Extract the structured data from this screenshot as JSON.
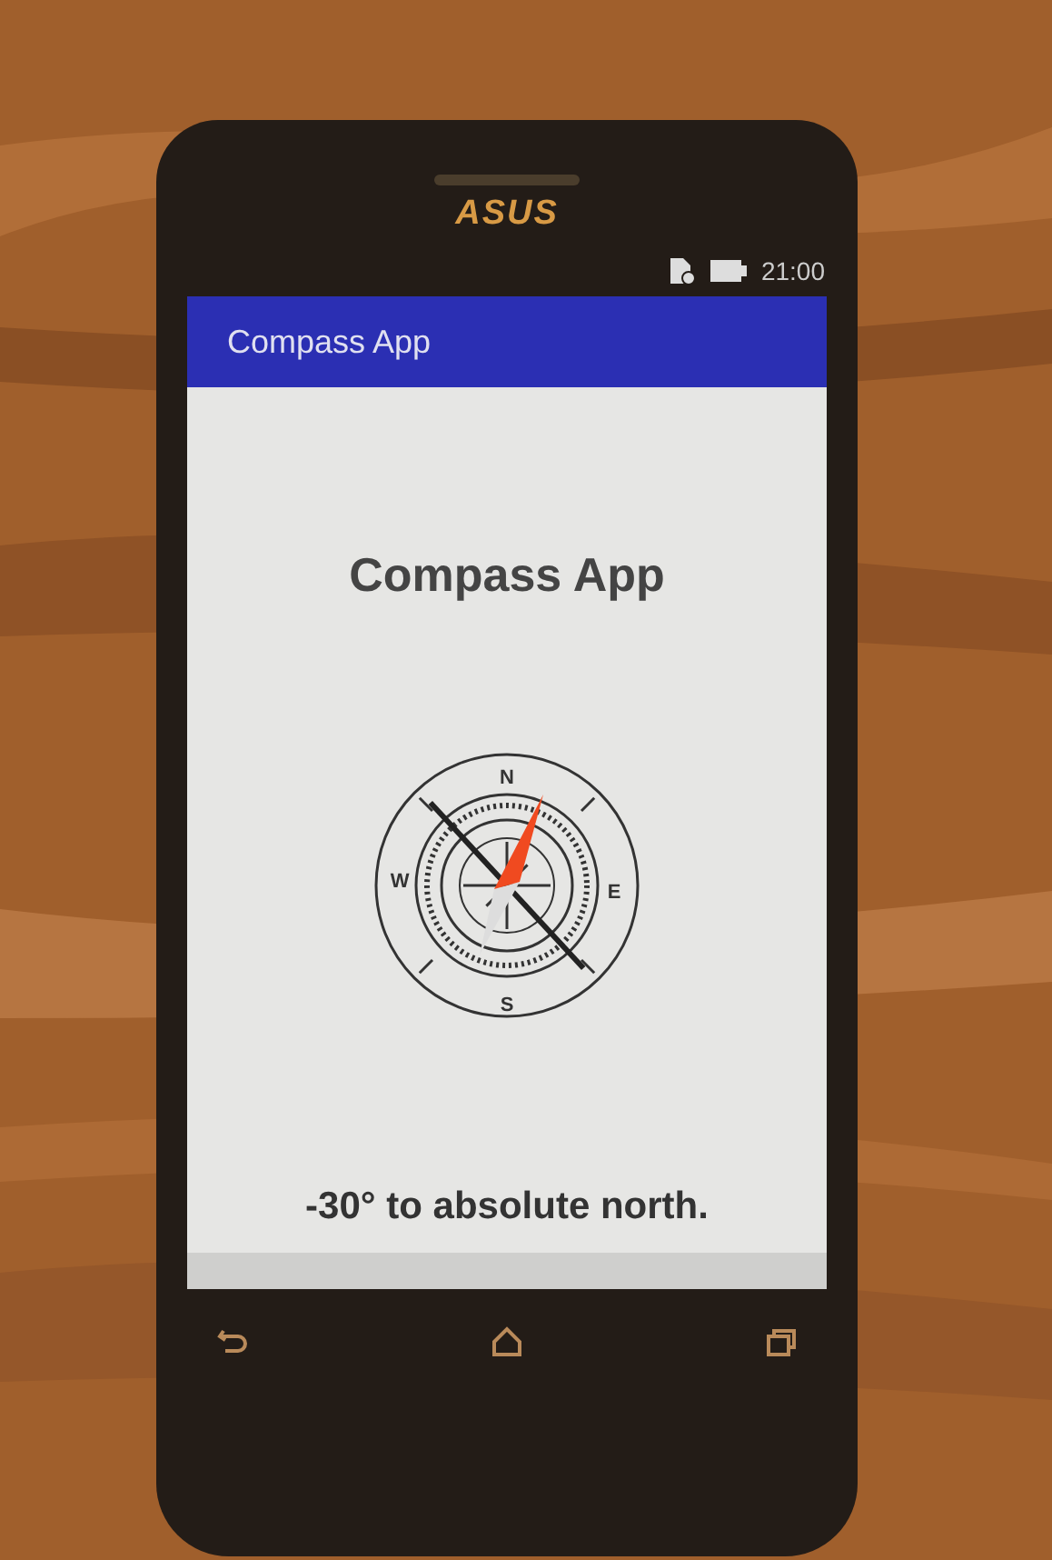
{
  "device": {
    "brand": "ASUS"
  },
  "status_bar": {
    "time": "21:00"
  },
  "app_bar": {
    "title": "Compass App"
  },
  "content": {
    "heading": "Compass App",
    "compass": {
      "letters": [
        "N",
        "E",
        "S",
        "W"
      ]
    },
    "reading": "-30° to absolute north."
  }
}
